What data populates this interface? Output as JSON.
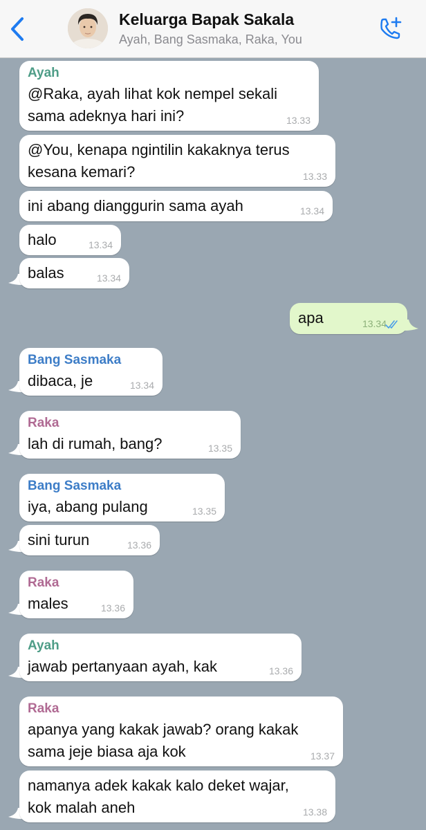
{
  "header": {
    "title": "Keluarga Bapak Sakala",
    "members": "Ayah, Bang Sasmaka, Raka, You"
  },
  "colors": {
    "background": "#9aa7b2",
    "accent": "#1e7bf0",
    "outgoing_bubble": "#e2f7cb",
    "sender_ayah": "#4e9d87",
    "sender_bang_sasmaka": "#3d7dc7",
    "sender_raka": "#b06a93"
  },
  "icons": {
    "back": "chevron-left-icon",
    "call": "phone-plus-icon",
    "read_receipt": "double-check-icon"
  },
  "messages": [
    {
      "sender": "Ayah",
      "text1": "@Raka, ayah lihat kok nempel sekali",
      "text2": "sama adeknya hari ini?",
      "time": "13.33"
    },
    {
      "text1": "@You, kenapa ngintilin kakaknya terus",
      "text2": "kesana kemari?",
      "time": "13.33"
    },
    {
      "text": "ini abang dianggurin sama ayah",
      "time": "13.34"
    },
    {
      "text": "halo",
      "time": "13.34"
    },
    {
      "text": "balas",
      "time": "13.34"
    },
    {
      "text": "apa",
      "time": "13.34",
      "outgoing": true,
      "status": "read"
    },
    {
      "sender": "Bang Sasmaka",
      "text": "dibaca, je",
      "time": "13.34"
    },
    {
      "sender": "Raka",
      "text": "lah di rumah, bang?",
      "time": "13.35"
    },
    {
      "sender": "Bang Sasmaka",
      "text": "iya, abang pulang",
      "time": "13.35"
    },
    {
      "text": "sini turun",
      "time": "13.36"
    },
    {
      "sender": "Raka",
      "text": "males",
      "time": "13.36"
    },
    {
      "sender": "Ayah",
      "text": "jawab pertanyaan ayah, kak",
      "time": "13.36"
    },
    {
      "sender": "Raka",
      "text1": "apanya yang kakak jawab? orang kakak",
      "text2": "sama jeje biasa aja kok",
      "time": "13.37"
    },
    {
      "text1": "namanya adek kakak kalo deket wajar,",
      "text2": "kok malah aneh",
      "time": "13.38"
    }
  ]
}
